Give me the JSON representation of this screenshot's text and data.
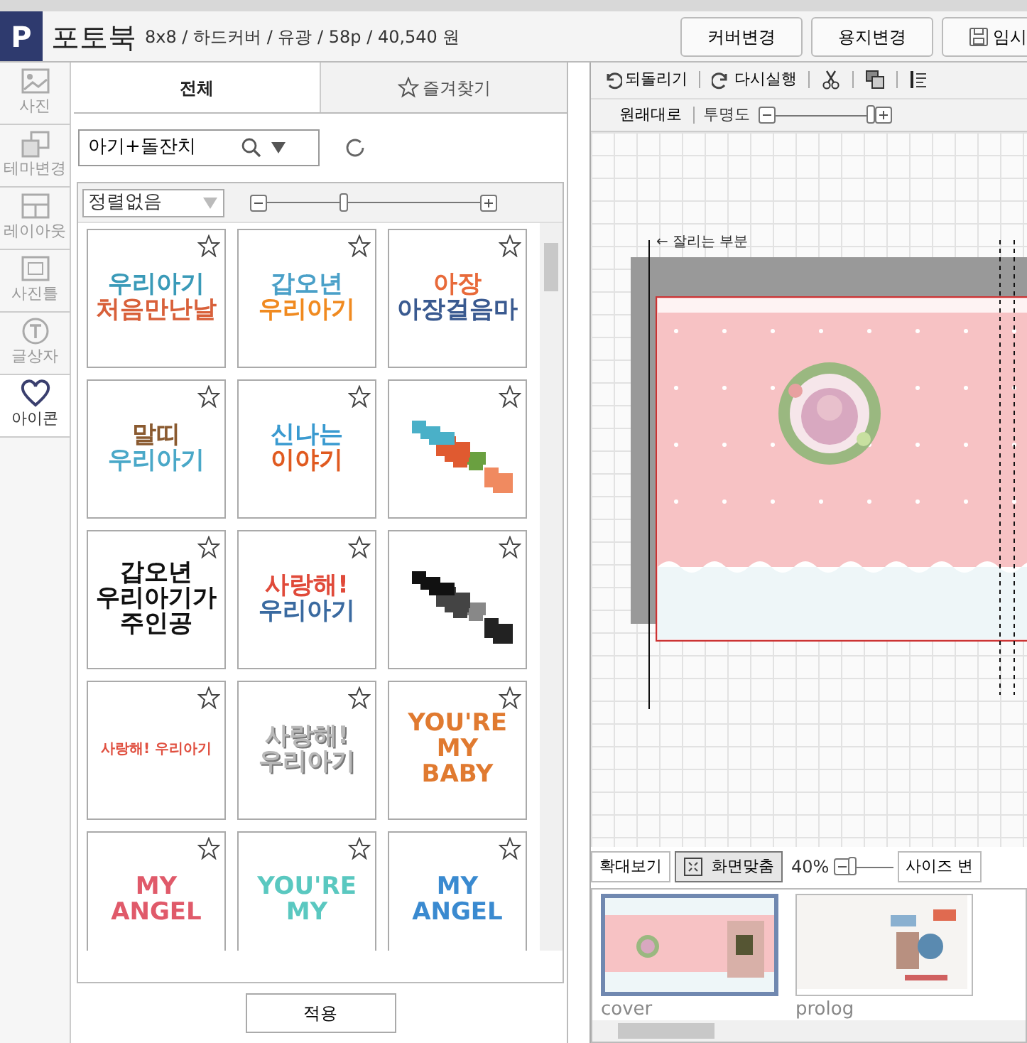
{
  "header": {
    "logo": "P",
    "title": "포토북",
    "spec": "8x8 / 하드커버 / 유광 / 58p / 40,540 원",
    "buttons": [
      {
        "label": "커버변경",
        "kind": "text"
      },
      {
        "label": "용지변경",
        "kind": "text"
      },
      {
        "label": "임시",
        "kind": "save"
      }
    ]
  },
  "sidebar": {
    "items": [
      {
        "label": "사진",
        "selected": false
      },
      {
        "label": "테마변경",
        "kind": "theme",
        "selected": false
      },
      {
        "label": "레이아웃",
        "kind": "layout",
        "selected": false
      },
      {
        "label": "사진틀",
        "kind": "frame",
        "selected": false
      },
      {
        "label": "글상자",
        "kind": "text",
        "selected": false
      },
      {
        "label": "아이콘",
        "kind": "heart",
        "selected": true
      }
    ]
  },
  "panel": {
    "tabs": [
      {
        "label": "전체",
        "kind": "all",
        "selected": true
      },
      {
        "label": "즐겨찾기",
        "kind": "star",
        "selected": false
      }
    ],
    "search": {
      "value": "아기+돌잔치"
    },
    "sort": {
      "value": "정렬없음"
    },
    "size_slider": {
      "level": 0.36
    },
    "stickers": [
      {
        "kind": "text",
        "favorite": false,
        "lines": [
          {
            "text": "우리아기",
            "color": "#3a9ab8"
          },
          {
            "text": "처음만난날",
            "color": "#d8603a"
          }
        ]
      },
      {
        "kind": "text",
        "favorite": false,
        "lines": [
          {
            "text": "갑오년",
            "color": "#4aa0c8"
          },
          {
            "text": "우리아기",
            "color": "#f08a20"
          }
        ]
      },
      {
        "kind": "text",
        "favorite": false,
        "lines": [
          {
            "text": "아장",
            "color": "#e86a3a"
          },
          {
            "text": "아장걸음마",
            "color": "#3a5a90"
          }
        ]
      },
      {
        "kind": "text",
        "favorite": false,
        "lines": [
          {
            "text": "말띠",
            "color": "#8a5a30"
          },
          {
            "text": "우리아기",
            "color": "#4aa8c8"
          }
        ]
      },
      {
        "kind": "text",
        "favorite": false,
        "lines": [
          {
            "text": "신나는",
            "color": "#3a9ad0"
          },
          {
            "text": "이야기",
            "color": "#e05a20"
          }
        ]
      },
      {
        "kind": "blurred",
        "favorite": false
      },
      {
        "kind": "text",
        "favorite": false,
        "lines": [
          {
            "text": "갑오년",
            "color": "#111111"
          },
          {
            "text": "우리아기가",
            "color": "#111111"
          },
          {
            "text": "주인공",
            "color": "#111111"
          }
        ]
      },
      {
        "kind": "text",
        "favorite": false,
        "lines": [
          {
            "text": "사랑해!",
            "color": "#e04a3a"
          },
          {
            "text": "우리아기",
            "color": "#3a6aa0"
          }
        ]
      },
      {
        "kind": "blurred",
        "favorite": false
      },
      {
        "kind": "small",
        "favorite": false,
        "lines": [
          {
            "text": "사랑해! 우리아기",
            "color": "#e05040"
          }
        ]
      },
      {
        "kind": "embossed",
        "favorite": false,
        "lines": [
          {
            "text": "사랑해!",
            "color": "#b8b8b8"
          },
          {
            "text": "우리아기",
            "color": "#b8b8b8"
          }
        ]
      },
      {
        "kind": "text",
        "favorite": false,
        "lines": [
          {
            "text": "YOU'RE",
            "color": "#e07a30"
          },
          {
            "text": "MY",
            "color": "#e07a30"
          },
          {
            "text": "BABY",
            "color": "#e07a30"
          }
        ]
      },
      {
        "kind": "text",
        "favorite": false,
        "lines": [
          {
            "text": "MY",
            "color": "#e05a6a"
          },
          {
            "text": "ANGEL",
            "color": "#e05a6a"
          }
        ]
      },
      {
        "kind": "text",
        "favorite": false,
        "lines": [
          {
            "text": "YOU'RE",
            "color": "#5ac8c0"
          },
          {
            "text": "MY",
            "color": "#5ac8c0"
          }
        ]
      },
      {
        "kind": "text",
        "favorite": false,
        "lines": [
          {
            "text": "MY",
            "color": "#3a8ad0"
          },
          {
            "text": "ANGEL",
            "color": "#3a8ad0"
          }
        ]
      }
    ],
    "apply_button": "적용"
  },
  "editor": {
    "toolbar": [
      {
        "label": "되돌리기",
        "kind": "undo"
      },
      {
        "label": "다시실행",
        "kind": "redo"
      },
      {
        "kind": "cut"
      },
      {
        "kind": "copy"
      },
      {
        "kind": "align"
      }
    ],
    "reset_button": "원래대로",
    "opacity": {
      "label": "투명도",
      "level": 0.95
    },
    "cut_label": "← 잘리는 부분",
    "zoom_buttons": [
      {
        "label": "확대보기",
        "selected": false,
        "kind": "text"
      },
      {
        "label": "화면맞춤",
        "selected": true,
        "kind": "fit"
      }
    ],
    "zoom": {
      "reading": "40%",
      "level": 0.05
    },
    "size_button": "사이즈 변",
    "pages": [
      {
        "name": "cover",
        "selected": true
      },
      {
        "name": "prolog",
        "selected": false
      }
    ]
  }
}
